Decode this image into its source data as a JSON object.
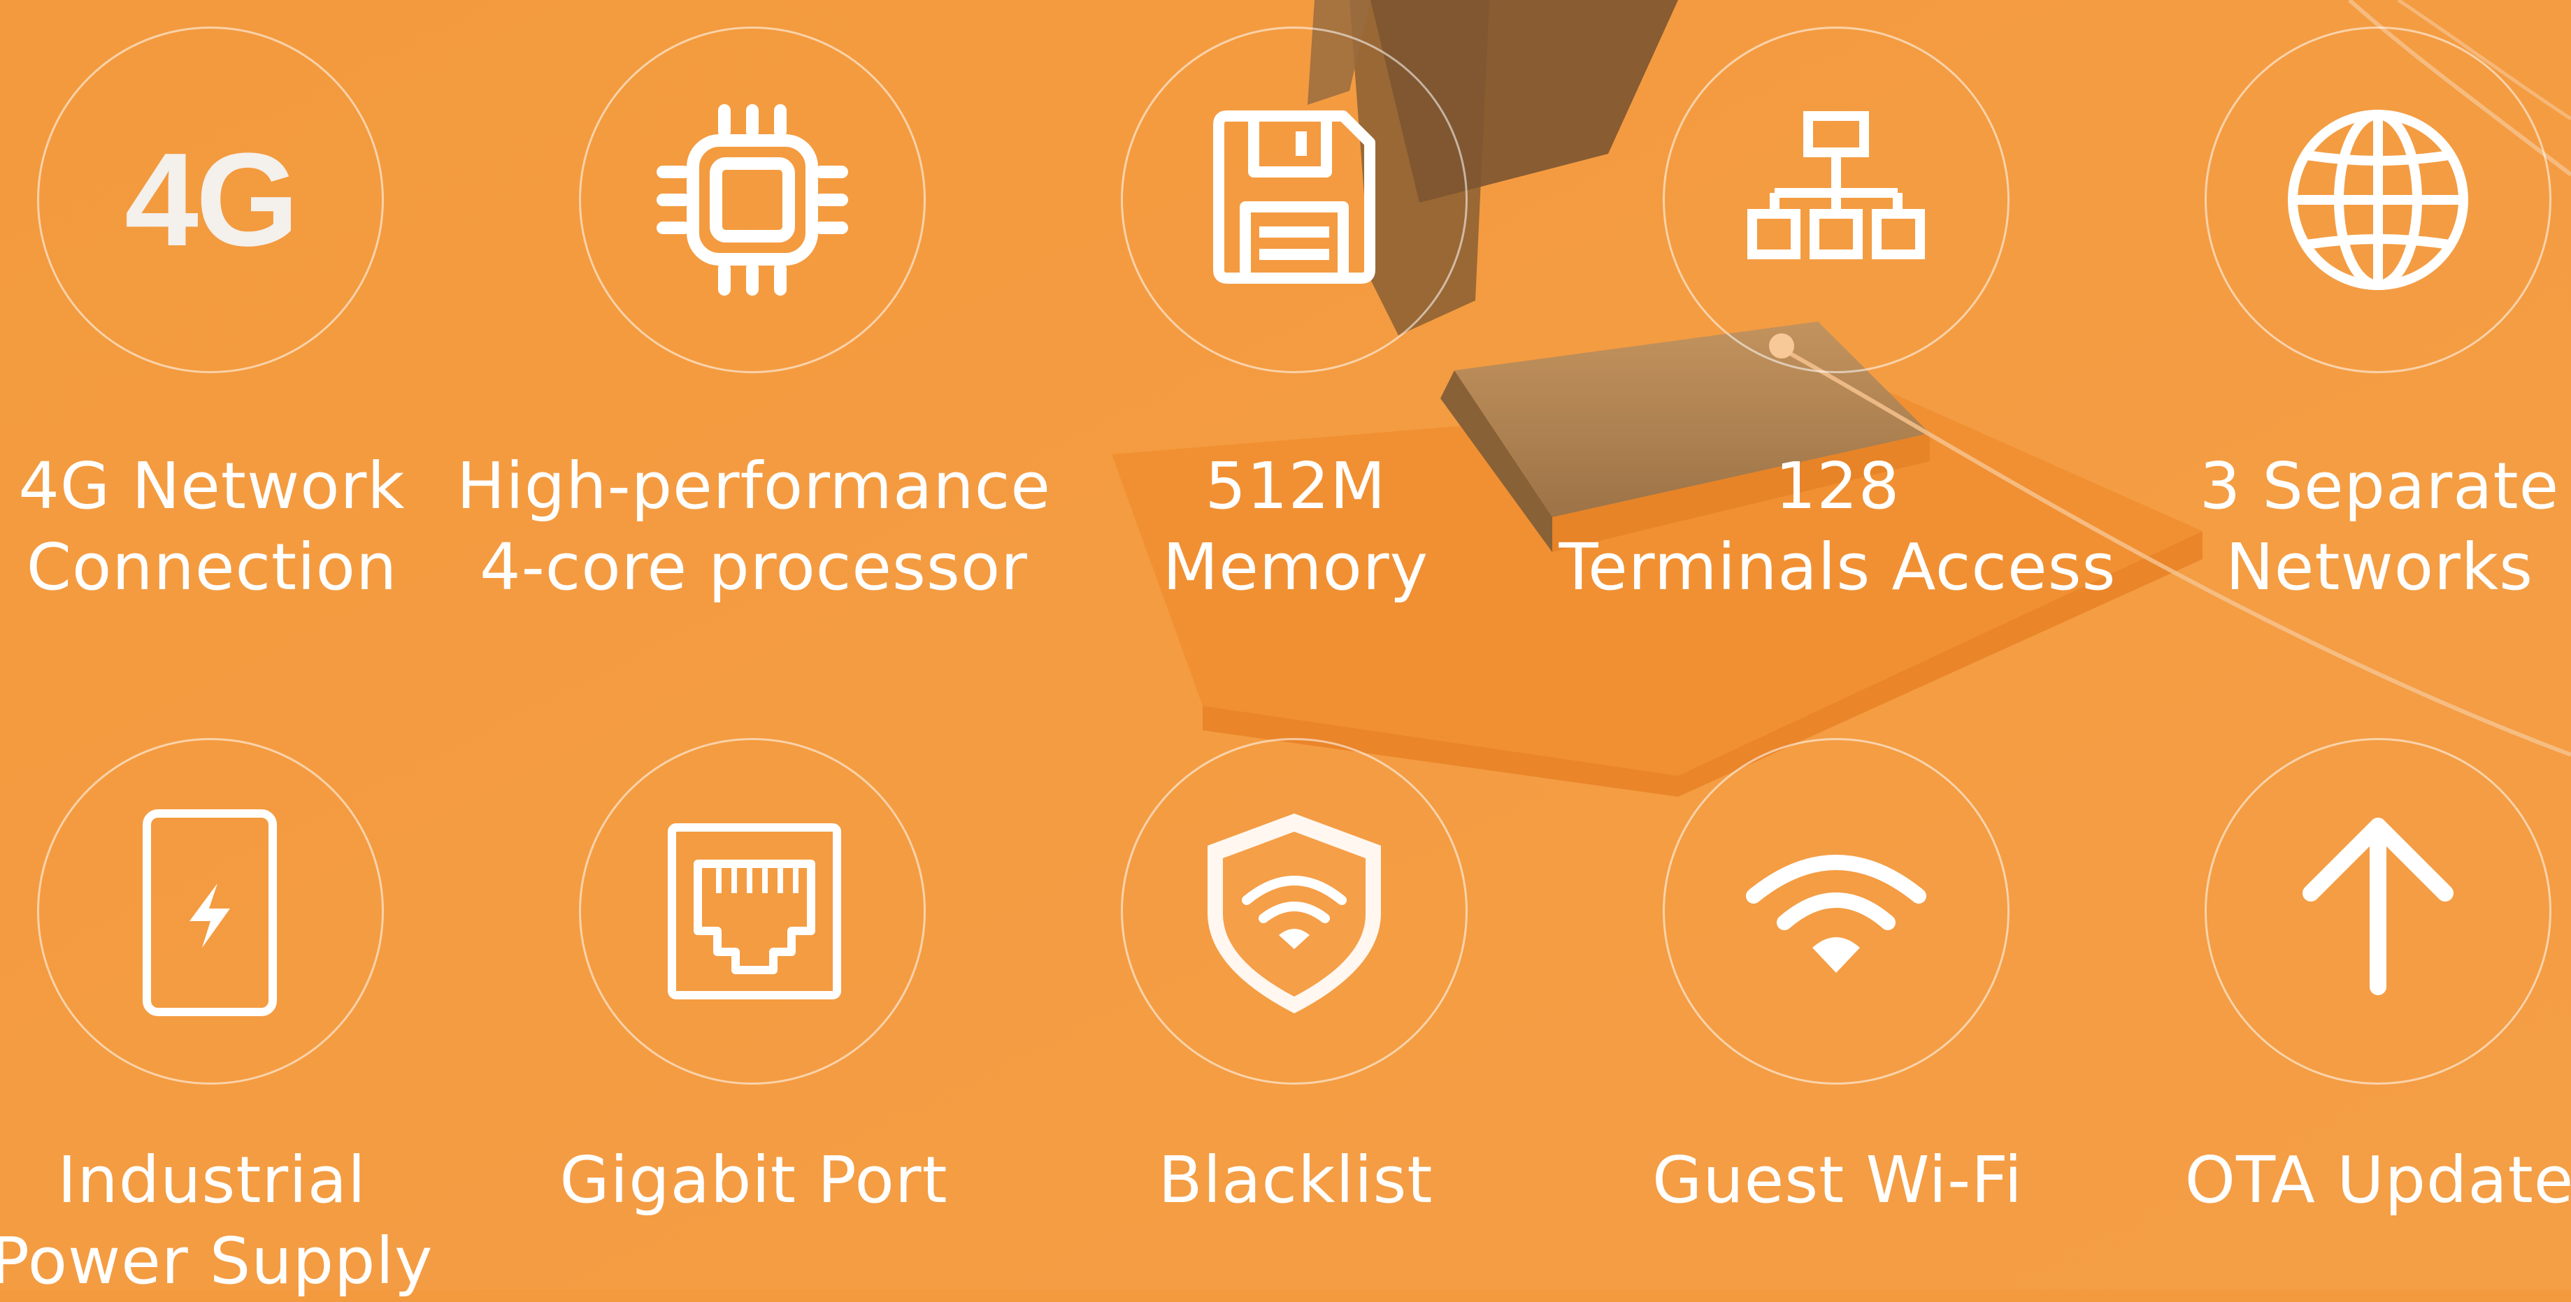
{
  "colors": {
    "background": "#f39a3f",
    "foreground": "#ffffff"
  },
  "features": [
    {
      "icon": "4g-icon",
      "icon_text": "4G",
      "lines": [
        "4G Network",
        "Connection"
      ]
    },
    {
      "icon": "cpu-chip-icon",
      "lines": [
        "High-performance",
        "4-core processor"
      ]
    },
    {
      "icon": "floppy-disk-icon",
      "lines": [
        "512M",
        "Memory"
      ]
    },
    {
      "icon": "network-topology-icon",
      "lines": [
        "128",
        "Terminals Access"
      ]
    },
    {
      "icon": "globe-icon",
      "lines": [
        "3 Separate",
        "Networks"
      ]
    },
    {
      "icon": "phone-charging-icon",
      "lines": [
        "Industrial",
        "Power Supply"
      ]
    },
    {
      "icon": "ethernet-port-icon",
      "lines": [
        "Gigabit Port"
      ]
    },
    {
      "icon": "shield-wifi-icon",
      "lines": [
        "Blacklist"
      ]
    },
    {
      "icon": "wifi-icon",
      "lines": [
        "Guest Wi-Fi"
      ]
    },
    {
      "icon": "arrow-up-icon",
      "lines": [
        "OTA Update"
      ]
    }
  ]
}
